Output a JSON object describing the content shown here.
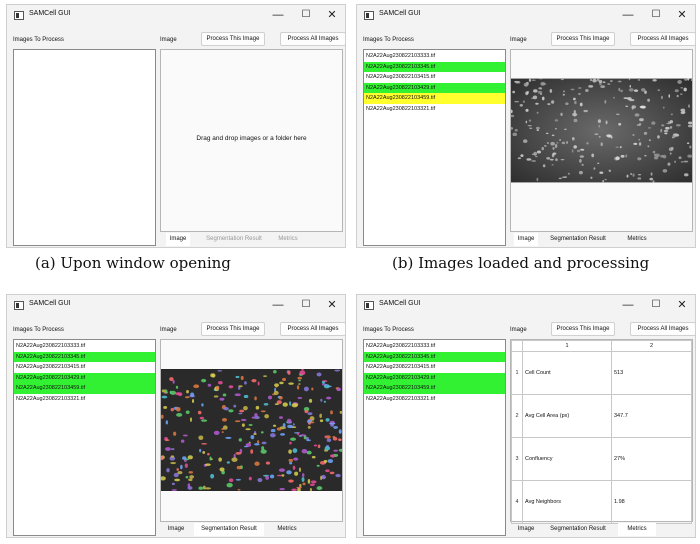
{
  "app": {
    "title": "SAMCell GUI",
    "controls": {
      "minimize": "—",
      "maximize": "☐",
      "close": "✕"
    },
    "images_to_process_label": "Images To Process",
    "image_label": "Image",
    "process_this_label": "Process This Image",
    "process_all_label": "Process All Images",
    "tabs": {
      "image": "Image",
      "segmentation": "Segmentation Result",
      "metrics": "Metrics"
    }
  },
  "panels": {
    "a": {
      "caption": "(a) Upon window opening",
      "drop_text": "Drag and drop images or a folder here",
      "files": [],
      "active_tab": "image"
    },
    "b": {
      "caption": "(b) Images loaded and processing",
      "files": [
        {
          "name": "N2A22Aug230822103333.tif",
          "status": "none"
        },
        {
          "name": "N2A22Aug230822103345.tif",
          "status": "done"
        },
        {
          "name": "N2A22Aug230822103415.tif",
          "status": "none"
        },
        {
          "name": "N2A22Aug230822103429.tif",
          "status": "done"
        },
        {
          "name": "N2A22Aug230822103459.tif",
          "status": "processing"
        },
        {
          "name": "N2A22Aug230822103321.tif",
          "status": "none"
        }
      ],
      "active_tab": "image"
    },
    "c": {
      "files": [
        {
          "name": "N2A22Aug230822103333.tif",
          "status": "none"
        },
        {
          "name": "N2A22Aug230822103345.tif",
          "status": "done"
        },
        {
          "name": "N2A22Aug230822103415.tif",
          "status": "none"
        },
        {
          "name": "N2A22Aug230822103429.tif",
          "status": "done"
        },
        {
          "name": "N2A22Aug230822103459.tif",
          "status": "done"
        },
        {
          "name": "N2A22Aug230822103321.tif",
          "status": "none"
        }
      ],
      "active_tab": "segmentation"
    },
    "d": {
      "files": [
        {
          "name": "N2A22Aug230822103333.tif",
          "status": "none"
        },
        {
          "name": "N2A22Aug230822103345.tif",
          "status": "done"
        },
        {
          "name": "N2A22Aug230822103415.tif",
          "status": "none"
        },
        {
          "name": "N2A22Aug230822103429.tif",
          "status": "done"
        },
        {
          "name": "N2A22Aug230822103459.tif",
          "status": "done"
        },
        {
          "name": "N2A22Aug230822103321.tif",
          "status": "none"
        }
      ],
      "active_tab": "metrics",
      "metrics": {
        "col_headers": [
          "1",
          "2"
        ],
        "rows": [
          {
            "index": "1",
            "name": "Cell Count",
            "value": "513"
          },
          {
            "index": "2",
            "name": "Avg Cell Area (px)",
            "value": "347.7"
          },
          {
            "index": "3",
            "name": "Confluency",
            "value": "27%"
          },
          {
            "index": "4",
            "name": "Avg Neighbors",
            "value": "1.98"
          }
        ]
      }
    }
  },
  "colors": {
    "done": "#32f032",
    "processing": "#ffff2e"
  }
}
